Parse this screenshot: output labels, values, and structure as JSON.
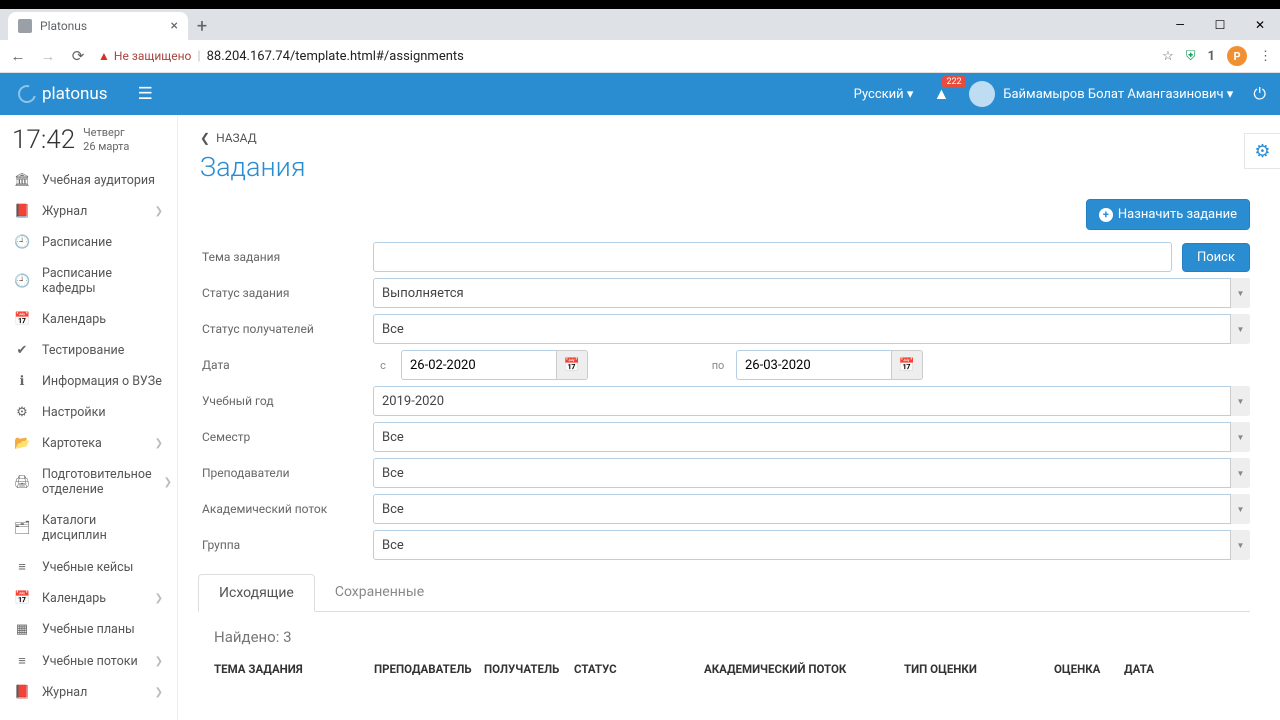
{
  "browser": {
    "tab_title": "Platonus",
    "insecure_label": "Не защищено",
    "url": "88.204.167.74/template.html#/assignments",
    "avatar_letter": "P"
  },
  "topbar": {
    "brand": "platonus",
    "language": "Русский ▾",
    "notifications": "222",
    "username": "Баймамыров Болат Амангазинович ▾"
  },
  "clock": {
    "time": "17:42",
    "weekday": "Четверг",
    "date": "26 марта"
  },
  "sidebar": {
    "items": [
      {
        "icon": "🏛",
        "label": "Учебная аудитория",
        "chev": false
      },
      {
        "icon": "📕",
        "label": "Журнал",
        "chev": true
      },
      {
        "icon": "🕘",
        "label": "Расписание",
        "chev": false
      },
      {
        "icon": "🕘",
        "label": "Расписание кафедры",
        "chev": false
      },
      {
        "icon": "📅",
        "label": "Календарь",
        "chev": false
      },
      {
        "icon": "✔",
        "label": "Тестирование",
        "chev": false
      },
      {
        "icon": "ℹ",
        "label": "Информация о ВУЗе",
        "chev": false
      },
      {
        "icon": "⚙",
        "label": "Настройки",
        "chev": false
      },
      {
        "icon": "📂",
        "label": "Картотека",
        "chev": true
      },
      {
        "icon": "🖨",
        "label": "Подготовительное отделение",
        "chev": true
      },
      {
        "icon": "🗂",
        "label": "Каталоги дисциплин",
        "chev": false
      },
      {
        "icon": "≡",
        "label": "Учебные кейсы",
        "chev": false
      },
      {
        "icon": "📅",
        "label": "Календарь",
        "chev": true
      },
      {
        "icon": "▦",
        "label": "Учебные планы",
        "chev": false
      },
      {
        "icon": "≡",
        "label": "Учебные потоки",
        "chev": true
      },
      {
        "icon": "📕",
        "label": "Журнал",
        "chev": true
      }
    ]
  },
  "page": {
    "back": "НАЗАД",
    "title": "Задания",
    "assign_btn": "Назначить задание"
  },
  "form": {
    "topic_label": "Тема задания",
    "search_btn": "Поиск",
    "status_label": "Статус задания",
    "status_value": "Выполняется",
    "recip_label": "Статус получателей",
    "recip_value": "Все",
    "date_label": "Дата",
    "date_from_lbl": "с",
    "date_from": "26-02-2020",
    "date_to_lbl": "по",
    "date_to": "26-03-2020",
    "year_label": "Учебный год",
    "year_value": "2019-2020",
    "sem_label": "Семестр",
    "sem_value": "Все",
    "teach_label": "Преподаватели",
    "teach_value": "Все",
    "stream_label": "Академический поток",
    "stream_value": "Все",
    "group_label": "Группа",
    "group_value": "Все"
  },
  "tabs": {
    "outgoing": "Исходящие",
    "saved": "Сохраненные"
  },
  "results": {
    "found": "Найдено: 3",
    "cols": [
      "ТЕМА ЗАДАНИЯ",
      "ПРЕПОДАВАТЕЛЬ",
      "ПОЛУЧАТЕЛЬ",
      "СТАТУС",
      "АКАДЕМИЧЕСКИЙ ПОТОК",
      "ТИП ОЦЕНКИ",
      "ОЦЕНКА",
      "ДАТА"
    ]
  }
}
